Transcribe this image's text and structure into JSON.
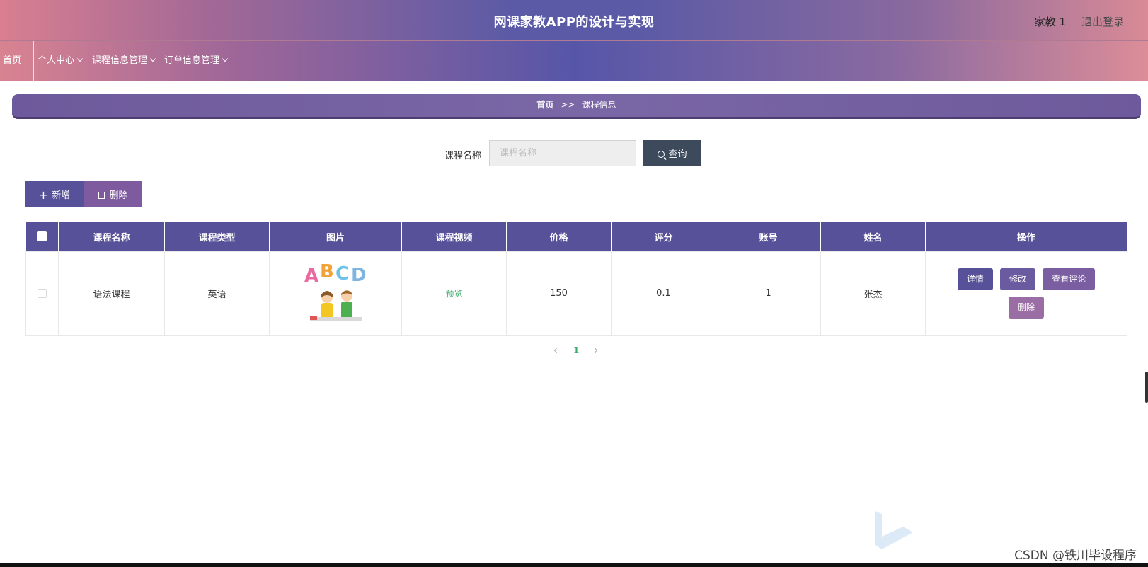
{
  "header": {
    "title": "网课家教APP的设计与实现",
    "user": "家教 1",
    "logout": "退出登录"
  },
  "nav": {
    "items": [
      {
        "label": "首页",
        "has_dropdown": false
      },
      {
        "label": "个人中心",
        "has_dropdown": true
      },
      {
        "label": "课程信息管理",
        "has_dropdown": true
      },
      {
        "label": "订单信息管理",
        "has_dropdown": true
      }
    ]
  },
  "breadcrumb": {
    "home": "首页",
    "sep": ">>",
    "current": "课程信息"
  },
  "search": {
    "label": "课程名称",
    "placeholder": "课程名称",
    "value": "",
    "button": "查询"
  },
  "actions": {
    "add": "新增",
    "delete": "删除"
  },
  "table": {
    "columns": [
      "课程名称",
      "课程类型",
      "图片",
      "课程视频",
      "价格",
      "评分",
      "账号",
      "姓名",
      "操作"
    ],
    "rows": [
      {
        "name": "语法课程",
        "type": "英语",
        "video": "预览",
        "price": "150",
        "rating": "0.1",
        "account": "1",
        "person": "张杰",
        "ops": {
          "detail": "详情",
          "edit": "修改",
          "review": "查看评论",
          "delete": "删除"
        }
      }
    ]
  },
  "pager": {
    "current": "1"
  },
  "watermark": {
    "text": "CSDN @铁川毕设程序"
  },
  "colors": {
    "primary": "#575199",
    "accent_green": "#3aa86a",
    "search_btn": "#3c4a5c"
  },
  "thumbnail_letters": [
    "A",
    "B",
    "C",
    "D"
  ]
}
